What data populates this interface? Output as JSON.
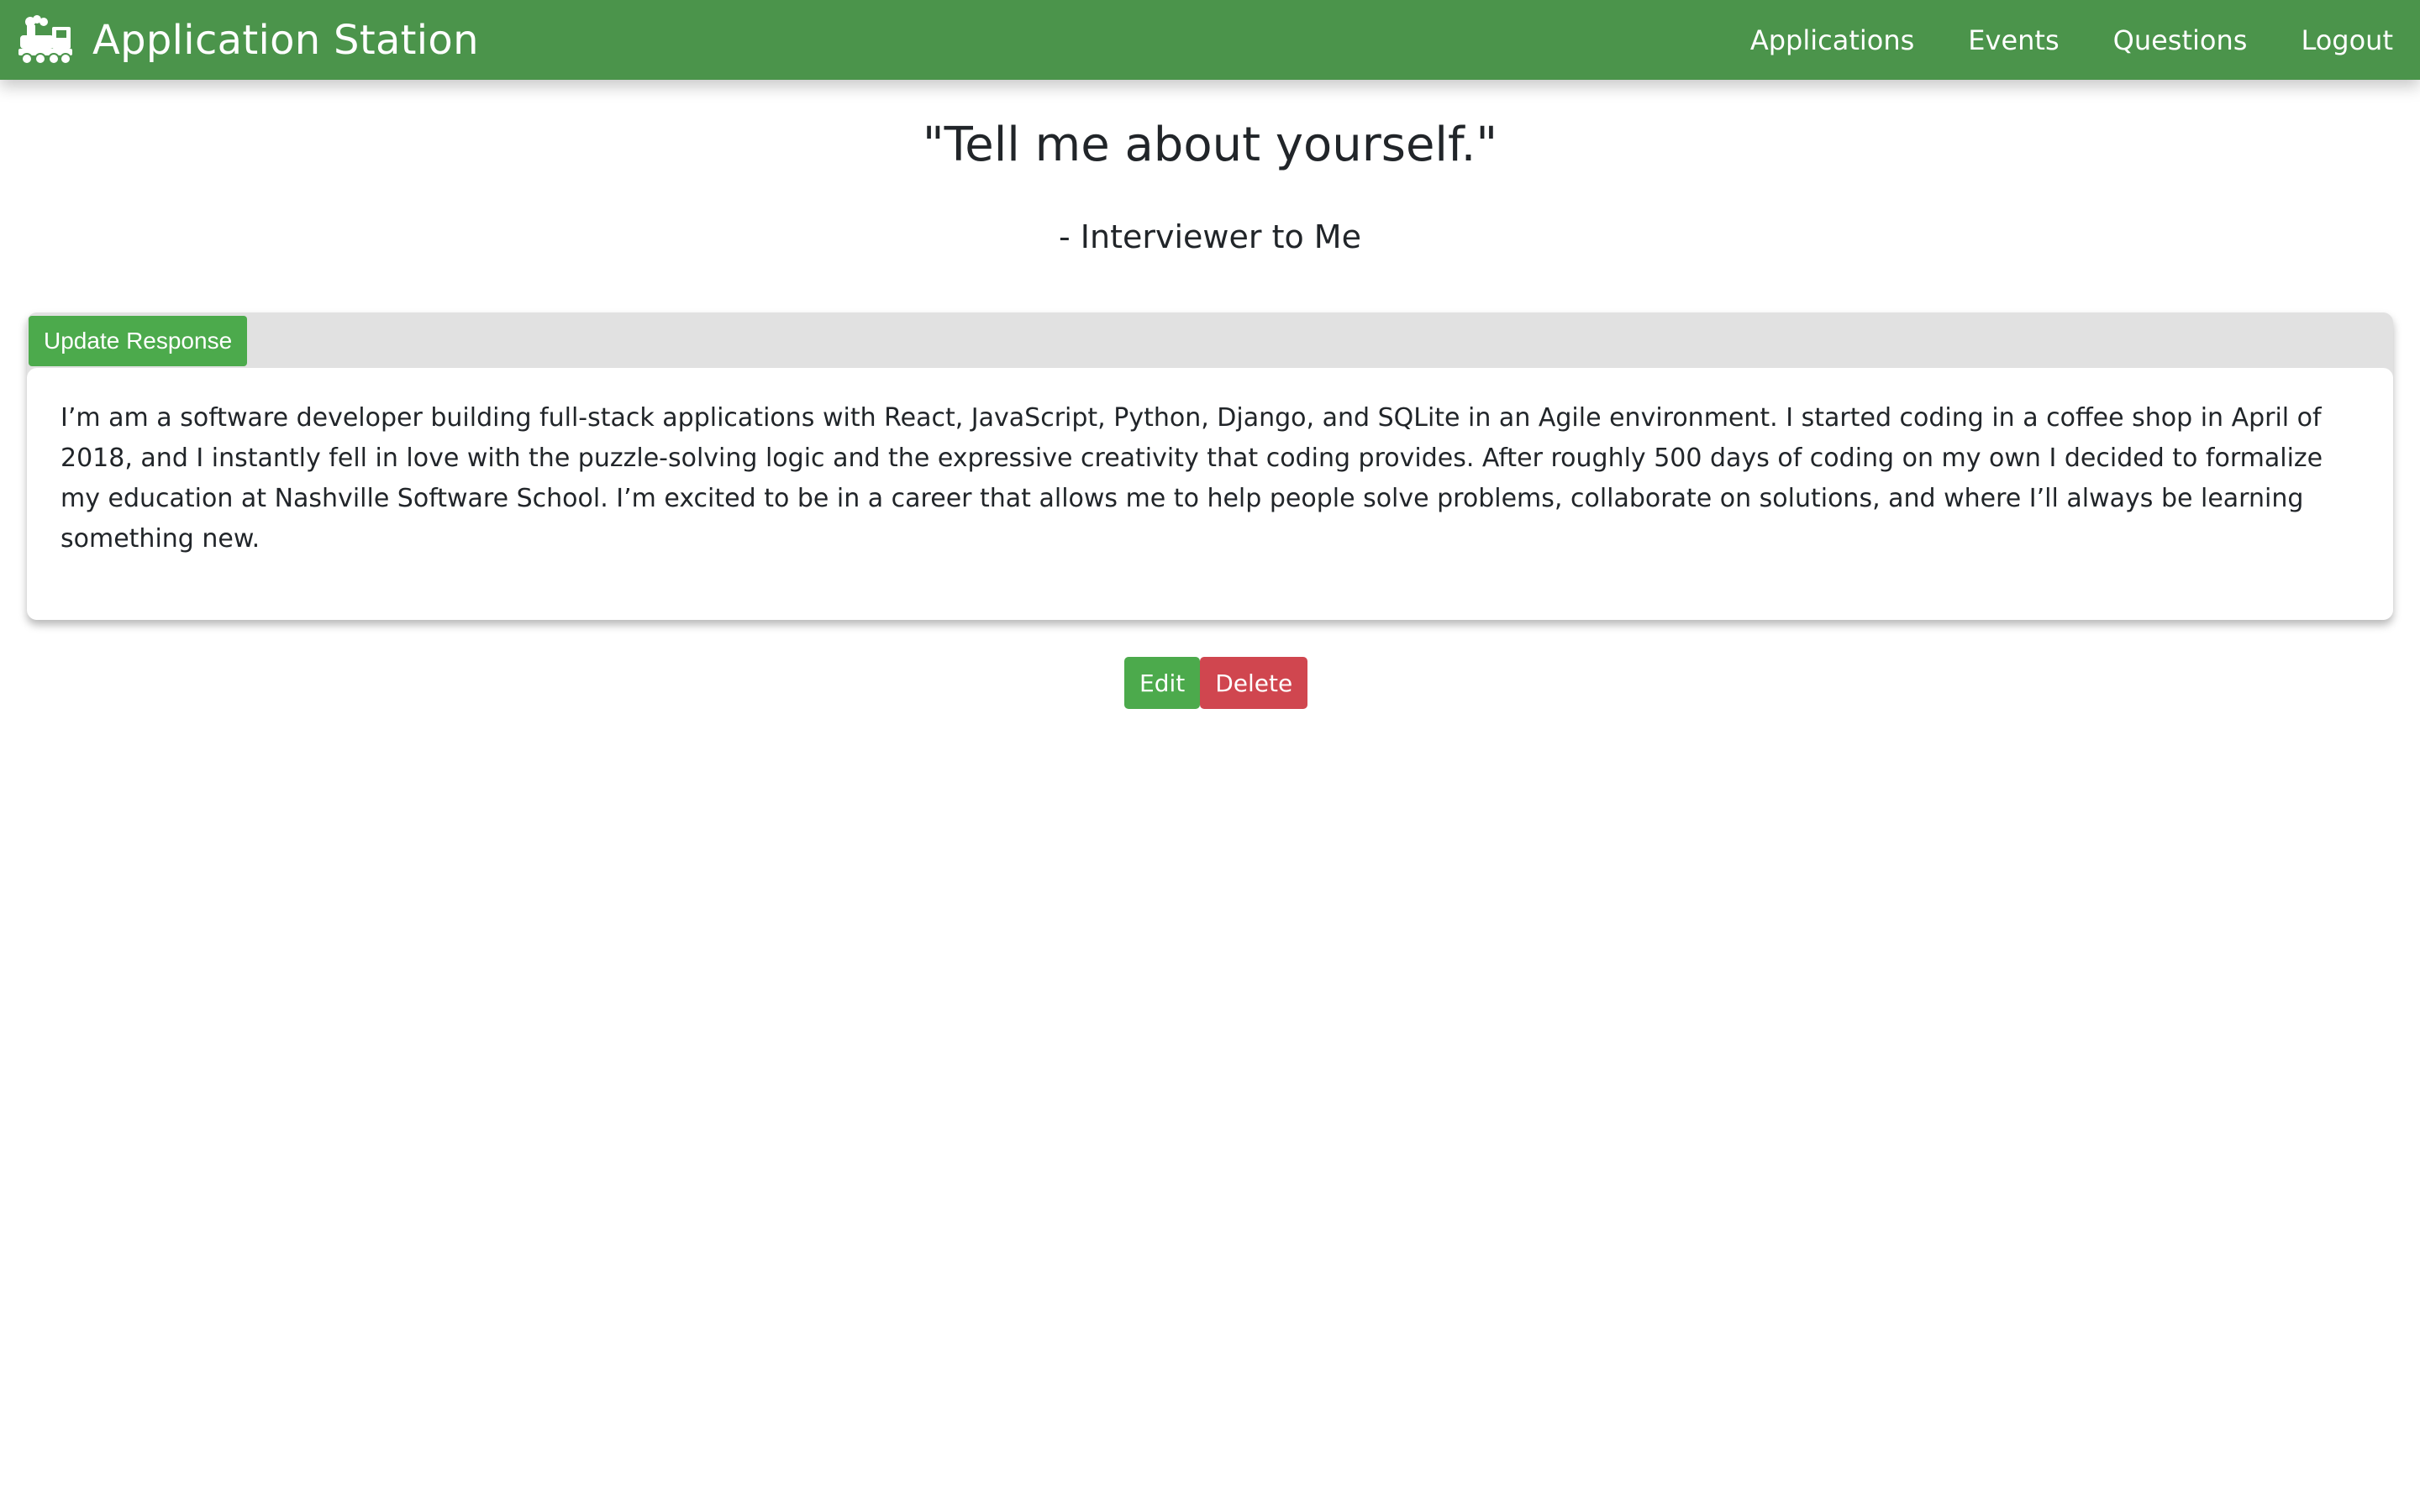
{
  "navbar": {
    "brand_icon": "train-icon",
    "brand_title": "Application Station",
    "links": [
      "Applications",
      "Events",
      "Questions",
      "Logout"
    ],
    "color": "#4b944b"
  },
  "question": {
    "title": "\"Tell me about yourself.\"",
    "attribution": "- Interviewer to Me"
  },
  "response": {
    "update_label": "Update Response",
    "text": "I’m am a software developer building full-stack applications with React, JavaScript, Python, Django, and SQLite in an Agile environment. I started coding in a coffee shop in April of 2018, and I instantly fell in love with the puzzle-solving logic and the expressive creativity that coding provides. After roughly 500 days of coding on my own I decided to formalize my education at Nashville Software School. I’m excited to be in a career that allows me to help people solve problems, collaborate on solutions, and where I’ll always be learning something new."
  },
  "actions": {
    "edit_label": "Edit",
    "delete_label": "Delete",
    "edit_color": "#4caa4c",
    "delete_color": "#d0464f"
  }
}
